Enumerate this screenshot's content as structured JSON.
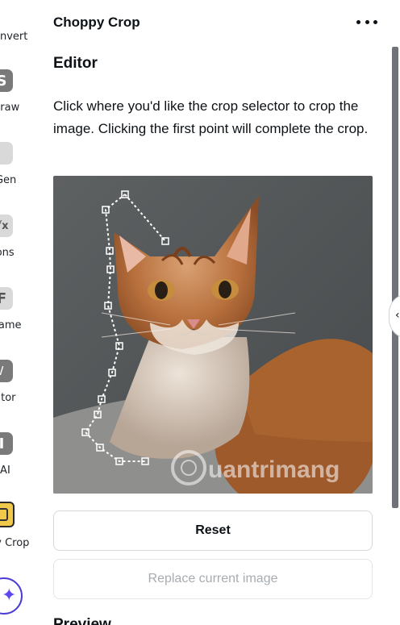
{
  "sidebar": {
    "items": [
      {
        "label": "onvert",
        "icon": "convert-icon"
      },
      {
        "label": "draw",
        "icon": "draw-app-icon"
      },
      {
        "label": "oGen",
        "icon": "gen-app-icon"
      },
      {
        "label": "tions",
        "icon": "equations-app-icon"
      },
      {
        "label": "Frame",
        "icon": "frame-app-icon"
      },
      {
        "label": "cator",
        "icon": "locator-app-icon"
      },
      {
        "label": "rf AI",
        "icon": "ai-app-icon"
      },
      {
        "label": "py Crop",
        "icon": "choppy-crop-app-icon"
      }
    ],
    "assistant_icon": "sparkle-icon"
  },
  "panel": {
    "app_title": "Choppy Crop",
    "more_icon": "more-horizontal-icon",
    "section_title": "Editor",
    "description": "Click where you'd like the crop selector to crop the image. Clicking the first point will complete the crop.",
    "watermark": "uantrimang",
    "buttons": {
      "reset": "Reset",
      "replace": "Replace current image"
    },
    "next_section_title": "Preview"
  },
  "colors": {
    "text": "#0d1216",
    "disabled_text": "#a7acb1",
    "active_app": "#f1c94a",
    "assistant_accent": "#5b46f0"
  }
}
